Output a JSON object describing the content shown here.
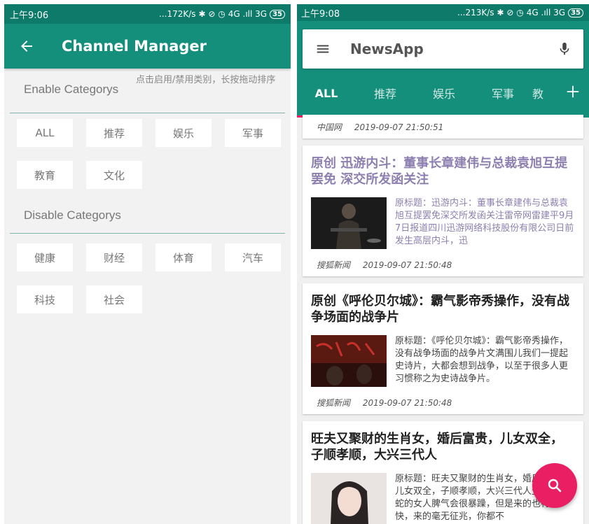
{
  "left": {
    "status": {
      "time": "上午9:06",
      "speed": "...172K/s",
      "network": "4G .ıll 3G",
      "battery": "35"
    },
    "title": "Channel Manager",
    "enable": {
      "title": "Enable Categorys",
      "hint": "点击启用/禁用类别，长按拖动排序",
      "items": [
        "ALL",
        "推荐",
        "娱乐",
        "军事",
        "教育",
        "文化"
      ]
    },
    "disable": {
      "title": "Disable Categorys",
      "items": [
        "健康",
        "财经",
        "体育",
        "汽车",
        "科技",
        "社会"
      ]
    }
  },
  "right": {
    "status": {
      "time": "上午9:08",
      "speed": "...213K/s",
      "network": "4G .ıll 3G",
      "battery": "35"
    },
    "app_name": "NewsApp",
    "tabs": [
      "ALL",
      "推荐",
      "娱乐",
      "军事",
      "教"
    ],
    "partial_card": {
      "source": "中国网",
      "time": "2019-09-07 21:50:51"
    },
    "articles": [
      {
        "title": "原创 迅游内斗：董事长章建伟与总裁袁旭互提罢免 深交所发函关注",
        "snippet": "原标题：迅游内斗：董事长章建伟与总裁袁旭互提罢免深交所发函关注雷帝网雷建平9月7日报道四川迅游网络科技股份有限公司日前发生高层内斗，迅",
        "source": "搜狐新闻",
        "time": "2019-09-07 21:50:48",
        "visited": true
      },
      {
        "title": "原创《呼伦贝尔城》：霸气影帝秀操作，没有战争场面的战争片",
        "snippet": "原标题：《呼伦贝尔城》：霸气影帝秀操作，没有战争场面的战争片文满围儿我们一提起史诗片，大都会想到战争，以至于很多人更习惯称之为史诗战争片。",
        "source": "搜狐新闻",
        "time": "2019-09-07 21:50:48",
        "visited": false
      },
      {
        "title": "旺夫又聚财的生肖女，婚后富贵，儿女双全，子顺孝顺，大兴三代人",
        "snippet": "原标题：旺夫又聚财的生肖女，婚后富贵，儿女双全，子顺孝顺，大兴三代人生肖蛇属蛇的女人脾气会很暴躁，但是来的也特别快，来的毫无征兆，你都不",
        "source": "",
        "time": "",
        "visited": false
      }
    ]
  },
  "colors": {
    "primary": "#148f7c",
    "primary_dark": "#0d7a6a",
    "accent": "#e91e63"
  }
}
